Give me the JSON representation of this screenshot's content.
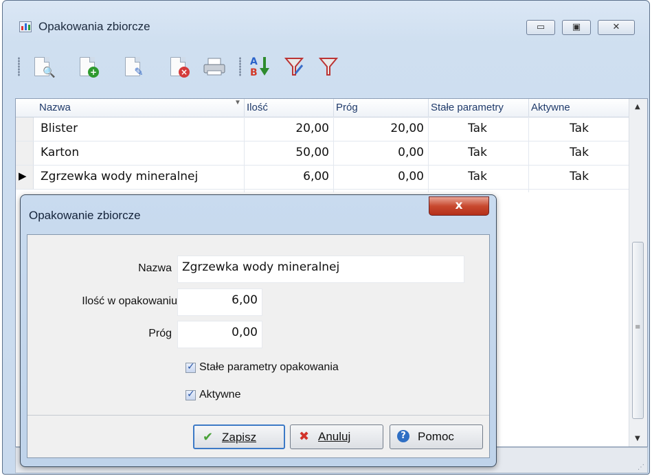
{
  "window": {
    "title": "Opakowania zbiorcze"
  },
  "toolbar": {
    "icons": [
      "preview-document-icon",
      "add-document-icon",
      "edit-document-icon",
      "delete-document-icon",
      "print-icon",
      "sort-az-icon",
      "filter-edit-icon",
      "filter-icon"
    ]
  },
  "grid": {
    "columns": [
      "Nazwa",
      "Ilość",
      "Próg",
      "Stałe parametry",
      "Aktywne"
    ],
    "rows": [
      {
        "nazwa": "Blister",
        "ilosc": "20,00",
        "prog": "20,00",
        "stale": "Tak",
        "aktywne": "Tak"
      },
      {
        "nazwa": "Karton",
        "ilosc": "50,00",
        "prog": "0,00",
        "stale": "Tak",
        "aktywne": "Tak"
      },
      {
        "nazwa": "Zgrzewka wody mineralnej",
        "ilosc": "6,00",
        "prog": "0,00",
        "stale": "Tak",
        "aktywne": "Tak"
      }
    ],
    "current_row_marker": "▶"
  },
  "dialog": {
    "title": "Opakowanie zbiorcze",
    "close_glyph": "x",
    "nazwa_label": "Nazwa",
    "nazwa_value": "Zgrzewka wody mineralnej",
    "ilosc_label": "Ilość w opakowaniu",
    "ilosc_value": "6,00",
    "prog_label": "Próg",
    "prog_value": "0,00",
    "stale_label": "Stałe parametry opakowania",
    "stale_checked": true,
    "aktywne_label": "Aktywne",
    "aktywne_checked": true,
    "save_label": "Zapisz",
    "cancel_label": "Anuluj",
    "help_label": "Pomoc",
    "check_glyph": "✓"
  },
  "colors": {
    "accent": "#3b79c6",
    "close_red": "#c8492f",
    "header_text": "#1f3a6a"
  }
}
